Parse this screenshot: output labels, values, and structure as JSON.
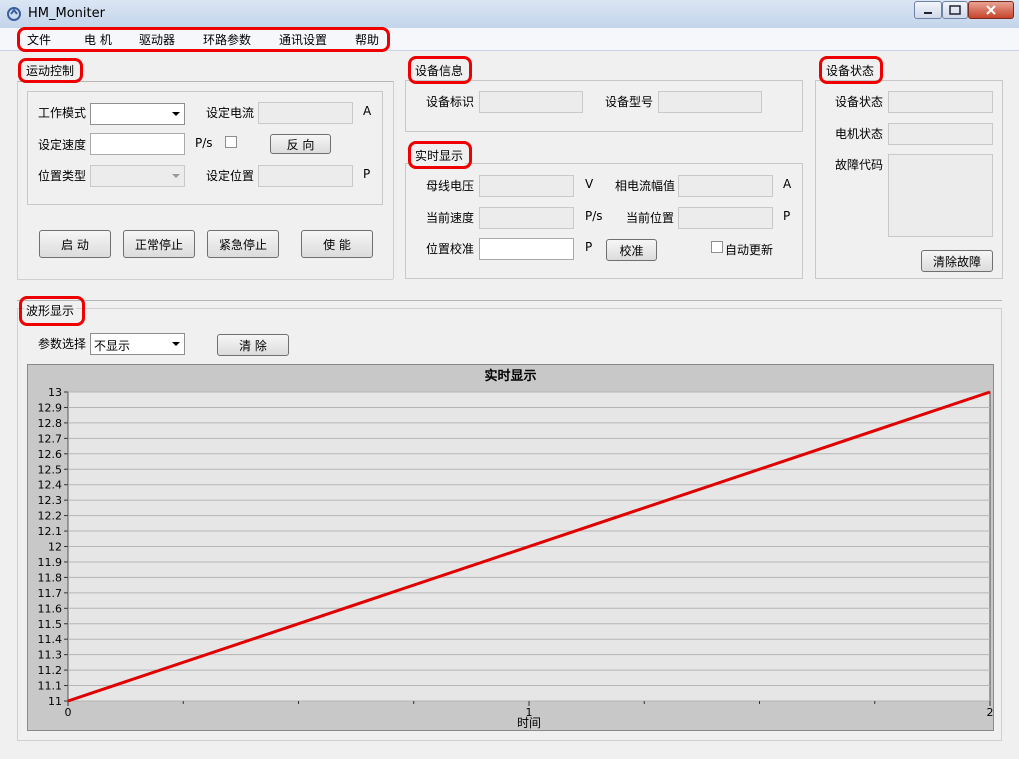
{
  "window": {
    "title": "HM_Moniter"
  },
  "menu": [
    "文件",
    "电 机",
    "驱动器",
    "环路参数",
    "通讯设置",
    "帮助"
  ],
  "motion": {
    "title": "运动控制",
    "work_mode_label": "工作模式",
    "set_current_label": "设定电流",
    "current_unit": "A",
    "set_speed_label": "设定速度",
    "speed_unit": "P/s",
    "reverse_button": "反 向",
    "position_type_label": "位置类型",
    "set_position_label": "设定位置",
    "position_unit": "P",
    "start_button": "启 动",
    "normal_stop_button": "正常停止",
    "emergency_stop_button": "紧急停止",
    "enable_button": "使 能"
  },
  "device_info": {
    "title": "设备信息",
    "device_id_label": "设备标识",
    "device_model_label": "设备型号"
  },
  "realtime": {
    "title": "实时显示",
    "bus_voltage_label": "母线电压",
    "voltage_unit": "V",
    "phase_current_label": "相电流幅值",
    "current_unit": "A",
    "current_speed_label": "当前速度",
    "speed_unit": "P/s",
    "current_position_label": "当前位置",
    "position_unit": "P",
    "position_calib_label": "位置校准",
    "calib_unit": "P",
    "calib_button": "校准",
    "auto_update_label": "自动更新"
  },
  "device_status": {
    "title": "设备状态",
    "device_state_label": "设备状态",
    "motor_state_label": "电机状态",
    "fault_code_label": "故障代码",
    "clear_fault_button": "清除故障"
  },
  "waveform": {
    "title": "波形显示",
    "param_select_label": "参数选择",
    "param_select_value": "不显示",
    "clear_button": "清 除"
  },
  "chart_data": {
    "type": "line",
    "title": "实时显示",
    "xlabel": "时间",
    "ylabel": "",
    "xlim": [
      0,
      2
    ],
    "ylim": [
      11,
      13
    ],
    "x_ticks": [
      "0",
      "1",
      "2"
    ],
    "y_ticks": [
      "11",
      "11.1",
      "11.2",
      "11.3",
      "11.4",
      "11.5",
      "11.6",
      "11.7",
      "11.8",
      "11.9",
      "12",
      "12.1",
      "12.2",
      "12.3",
      "12.4",
      "12.5",
      "12.6",
      "12.7",
      "12.8",
      "12.9",
      "13"
    ],
    "grid": true,
    "series": [
      {
        "x": [
          0,
          2
        ],
        "y": [
          11,
          13
        ],
        "color": "#e00000"
      }
    ]
  },
  "colors": {
    "annotation_ring": "#e00000",
    "line": "#e00000"
  }
}
